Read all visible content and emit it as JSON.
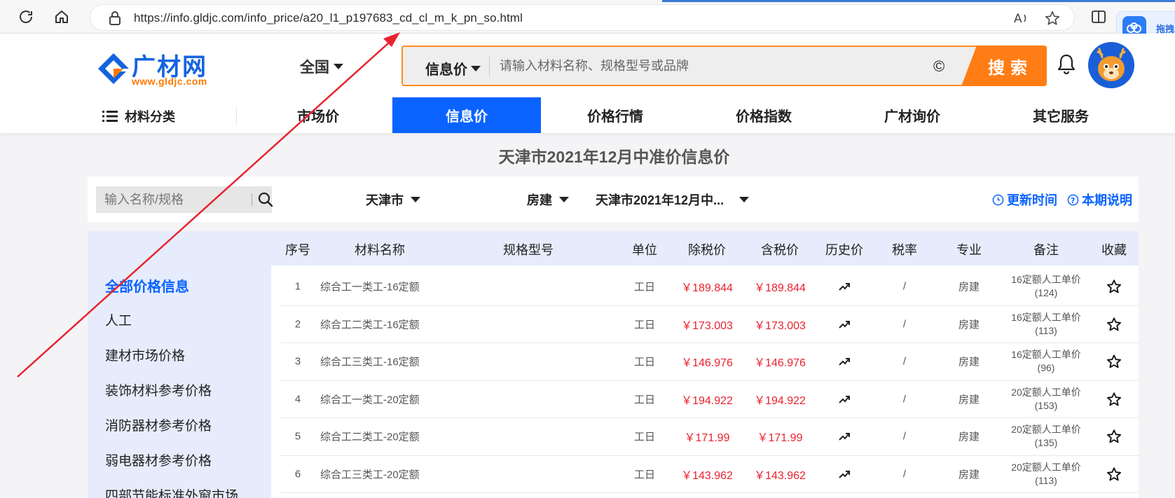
{
  "browser": {
    "url": "https://info.gldjc.com/info_price/a20_l1_p197683_cd_cl_m_k_pn_so.html",
    "extension_label": "拖拽",
    "accent": "#3a7bd5"
  },
  "header": {
    "logo_text": "广材网",
    "logo_url": "www.gldjc.com",
    "region": "全国",
    "search": {
      "type_label": "信息价",
      "placeholder": "请输入材料名称、规格型号或品牌",
      "copyright_glyph": "©",
      "button_label": "搜索"
    },
    "brand_color": "#0a63ff",
    "accent_orange": "#ff7d14"
  },
  "nav": {
    "category_label": "材料分类",
    "items": [
      "市场价",
      "信息价",
      "价格行情",
      "价格指数",
      "广材询价",
      "其它服务"
    ],
    "active_index": 1
  },
  "page_title": "天津市2021年12月中准价信息价",
  "filters": {
    "keyword_placeholder": "输入名称/规格",
    "city": "天津市",
    "category": "房建",
    "period": "天津市2021年12月中...",
    "update_time_label": "更新时间",
    "period_note_label": "本期说明"
  },
  "sidebar": {
    "items": [
      "全部价格信息",
      "人工",
      "建材市场价格",
      "装饰材料参考价格",
      "消防器材参考价格",
      "弱电器材参考价格",
      "四部节能标准外窗市场..."
    ],
    "active_index": 0
  },
  "table": {
    "headers": [
      "序号",
      "材料名称",
      "规格型号",
      "单位",
      "除税价",
      "含税价",
      "历史价",
      "税率",
      "专业",
      "备注",
      "收藏"
    ],
    "rows": [
      {
        "no": "1",
        "name": "综合工一类工-16定额",
        "spec": "",
        "unit": "工日",
        "price_ex": "￥189.844",
        "price_in": "￥189.844",
        "tax": "/",
        "major": "房建",
        "note1": "16定额人工单价",
        "note2": "(124)"
      },
      {
        "no": "2",
        "name": "综合工二类工-16定额",
        "spec": "",
        "unit": "工日",
        "price_ex": "￥173.003",
        "price_in": "￥173.003",
        "tax": "/",
        "major": "房建",
        "note1": "16定额人工单价",
        "note2": "(113)"
      },
      {
        "no": "3",
        "name": "综合工三类工-16定额",
        "spec": "",
        "unit": "工日",
        "price_ex": "￥146.976",
        "price_in": "￥146.976",
        "tax": "/",
        "major": "房建",
        "note1": "16定额人工单价",
        "note2": "(96)"
      },
      {
        "no": "4",
        "name": "综合工一类工-20定额",
        "spec": "",
        "unit": "工日",
        "price_ex": "￥194.922",
        "price_in": "￥194.922",
        "tax": "/",
        "major": "房建",
        "note1": "20定额人工单价",
        "note2": "(153)"
      },
      {
        "no": "5",
        "name": "综合工二类工-20定额",
        "spec": "",
        "unit": "工日",
        "price_ex": "￥171.99",
        "price_in": "￥171.99",
        "tax": "/",
        "major": "房建",
        "note1": "20定额人工单价",
        "note2": "(135)"
      },
      {
        "no": "6",
        "name": "综合工三类工-20定额",
        "spec": "",
        "unit": "工日",
        "price_ex": "￥143.962",
        "price_in": "￥143.962",
        "tax": "/",
        "major": "房建",
        "note1": "20定额人工单价",
        "note2": "(113)"
      }
    ]
  },
  "icons": [
    "refresh-icon",
    "home-icon",
    "lock-icon",
    "read-aloud-icon",
    "favorite-star-icon",
    "split-screen-icon",
    "cloud-icon",
    "dropdown-triangle-icon",
    "bell-icon",
    "avatar-deer-icon",
    "menu-list-icon",
    "magnifier-icon",
    "clock-icon",
    "help-circle-icon",
    "trend-arrow-icon",
    "star-outline-icon"
  ],
  "annotation_color": "#e8232f"
}
